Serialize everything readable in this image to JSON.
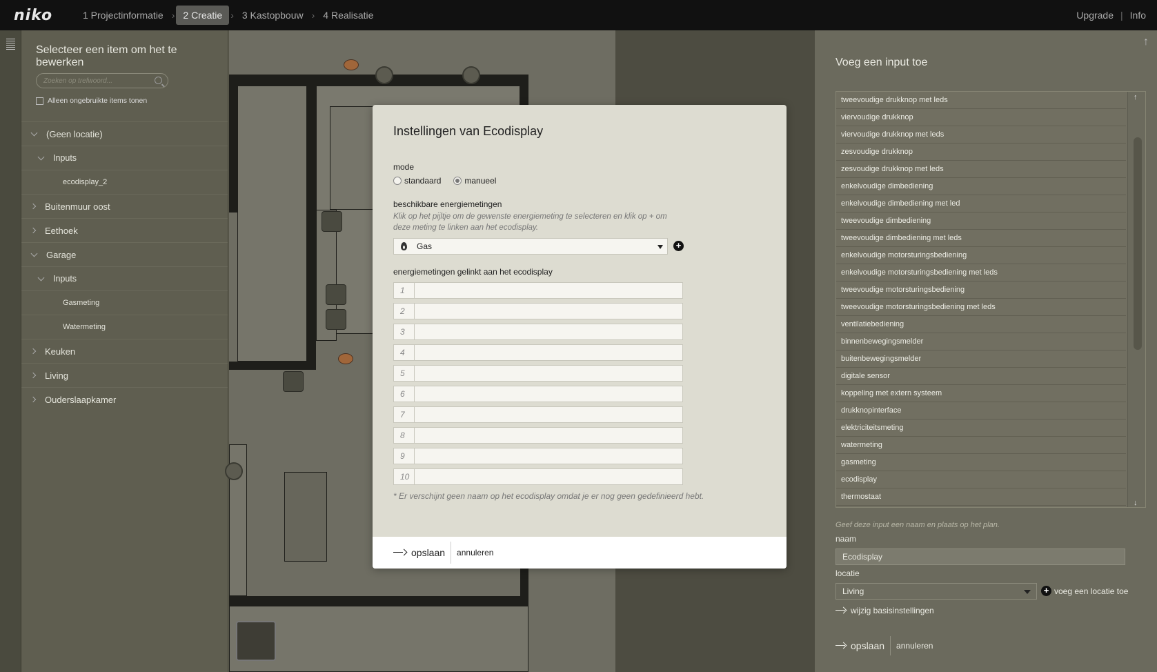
{
  "topbar": {
    "logo": "niko",
    "steps": [
      {
        "label": "1 Projectinformatie",
        "active": false
      },
      {
        "label": "2 Creatie",
        "active": true
      },
      {
        "label": "3 Kastopbouw",
        "active": false
      },
      {
        "label": "4 Realisatie",
        "active": false
      }
    ],
    "upgrade": "Upgrade",
    "info": "Info"
  },
  "sidebar": {
    "title": "Selecteer een item om het te bewerken",
    "search_placeholder": "Zoeken op trefwoord...",
    "filter_label": "Alleen ongebruikte items tonen",
    "tree": [
      {
        "label": "(Geen locatie)",
        "level": 1,
        "expanded": true
      },
      {
        "label": "Inputs",
        "level": 2,
        "expanded": true
      },
      {
        "label": "ecodisplay_2",
        "level": 3
      },
      {
        "label": "Buitenmuur oost",
        "level": 1,
        "expanded": false
      },
      {
        "label": "Eethoek",
        "level": 1,
        "expanded": false
      },
      {
        "label": "Garage",
        "level": 1,
        "expanded": true
      },
      {
        "label": "Inputs",
        "level": 2,
        "expanded": true
      },
      {
        "label": "Gasmeting",
        "level": 3
      },
      {
        "label": "Watermeting",
        "level": 3
      },
      {
        "label": "Keuken",
        "level": 1,
        "expanded": false
      },
      {
        "label": "Living",
        "level": 1,
        "expanded": false
      },
      {
        "label": "Ouderslaapkamer",
        "level": 1,
        "expanded": false
      }
    ]
  },
  "modal": {
    "title": "Instellingen van Ecodisplay",
    "mode_label": "mode",
    "mode_options": [
      "standaard",
      "manueel"
    ],
    "mode_selected": "manueel",
    "available_label": "beschikbare energiemetingen",
    "available_help": "Klik op het pijltje om de gewenste energiemeting te selecteren en klik op + om deze meting te linken aan het ecodisplay.",
    "selected_measurement": "Gas",
    "linked_label": "energiemetingen gelinkt aan het ecodisplay",
    "slots": [
      "1",
      "2",
      "3",
      "4",
      "5",
      "6",
      "7",
      "8",
      "9",
      "10"
    ],
    "note": "* Er verschijnt geen naam op het ecodisplay omdat je er nog geen gedefinieerd hebt.",
    "save": "opslaan",
    "cancel": "annuleren"
  },
  "rpanel": {
    "title": "Voeg een input toe",
    "inputs": [
      "tweevoudige drukknop met leds",
      "viervoudige drukknop",
      "viervoudige drukknop met leds",
      "zesvoudige drukknop",
      "zesvoudige drukknop met leds",
      "enkelvoudige dimbediening",
      "enkelvoudige dimbediening met led",
      "tweevoudige dimbediening",
      "tweevoudige dimbediening met leds",
      "enkelvoudige motorsturingsbediening",
      "enkelvoudige motorsturingsbediening met leds",
      "tweevoudige motorsturingsbediening",
      "tweevoudige motorsturingsbediening met leds",
      "ventilatiebediening",
      "binnenbewegingsmelder",
      "buitenbewegingsmelder",
      "digitale sensor",
      "koppeling met extern systeem",
      "drukknopinterface",
      "elektriciteitsmeting",
      "watermeting",
      "gasmeting",
      "ecodisplay",
      "thermostaat"
    ],
    "hint": "Geef deze input een naam en plaats op het plan.",
    "name_label": "naam",
    "name_value": "Ecodisplay",
    "location_label": "locatie",
    "location_value": "Living",
    "add_location": "voeg een locatie toe",
    "edit_basic": "wijzig basisinstellingen",
    "save": "opslaan",
    "cancel": "annuleren"
  }
}
